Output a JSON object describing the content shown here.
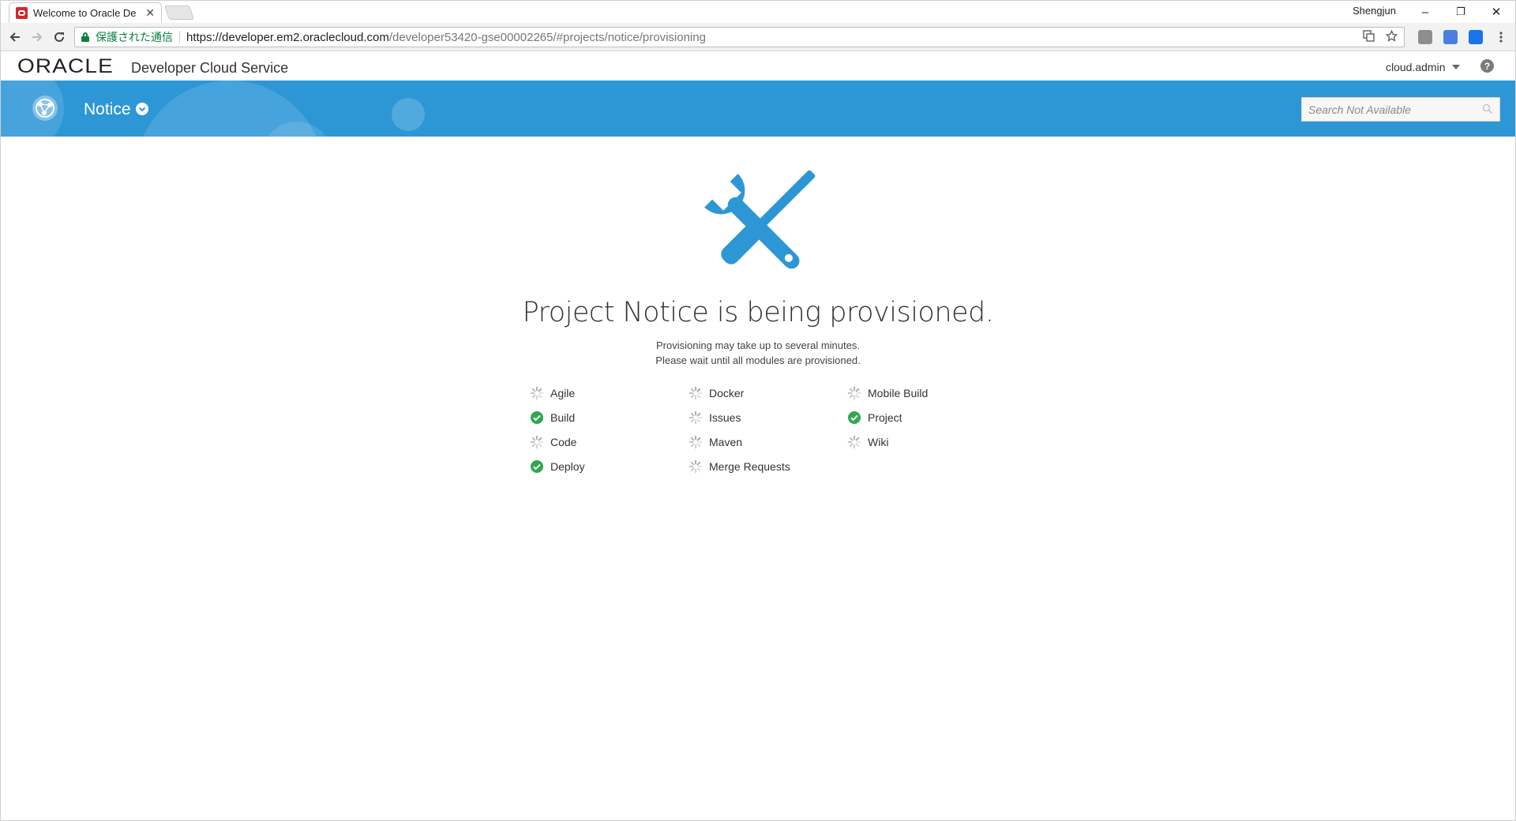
{
  "browser": {
    "tab_title": "Welcome to Oracle De",
    "tab_close": "✕",
    "profile_name": "Shengjun",
    "window_buttons": {
      "minimize": "–",
      "restore": "❐",
      "close": "✕"
    },
    "secure_label": "保護された通信",
    "url_host": "https://developer.em2.oraclecloud.com",
    "url_path": "/developer53420-gse00002265/#projects/notice/provisioning"
  },
  "header": {
    "logo": "ORACLE",
    "product_name": "Developer Cloud Service",
    "user_name": "cloud.admin",
    "help": "?"
  },
  "banner": {
    "project_name": "Notice",
    "search_placeholder": "Search Not Available"
  },
  "main": {
    "headline": "Project Notice is being provisioned.",
    "subtitle_line1": "Provisioning may take up to several minutes.",
    "subtitle_line2": "Please wait until all modules are provisioned.",
    "modules": [
      {
        "label": "Agile",
        "status": "pending"
      },
      {
        "label": "Build",
        "status": "done"
      },
      {
        "label": "Code",
        "status": "pending"
      },
      {
        "label": "Deploy",
        "status": "done"
      },
      {
        "label": "Docker",
        "status": "pending"
      },
      {
        "label": "Issues",
        "status": "pending"
      },
      {
        "label": "Maven",
        "status": "pending"
      },
      {
        "label": "Merge Requests",
        "status": "pending"
      },
      {
        "label": "Mobile Build",
        "status": "pending"
      },
      {
        "label": "Project",
        "status": "done"
      },
      {
        "label": "Wiki",
        "status": "pending"
      }
    ]
  },
  "colors": {
    "accent": "#2d97d6",
    "done": "#2ea84f",
    "pending": "#9a9a9a",
    "secure": "#0b8043"
  }
}
